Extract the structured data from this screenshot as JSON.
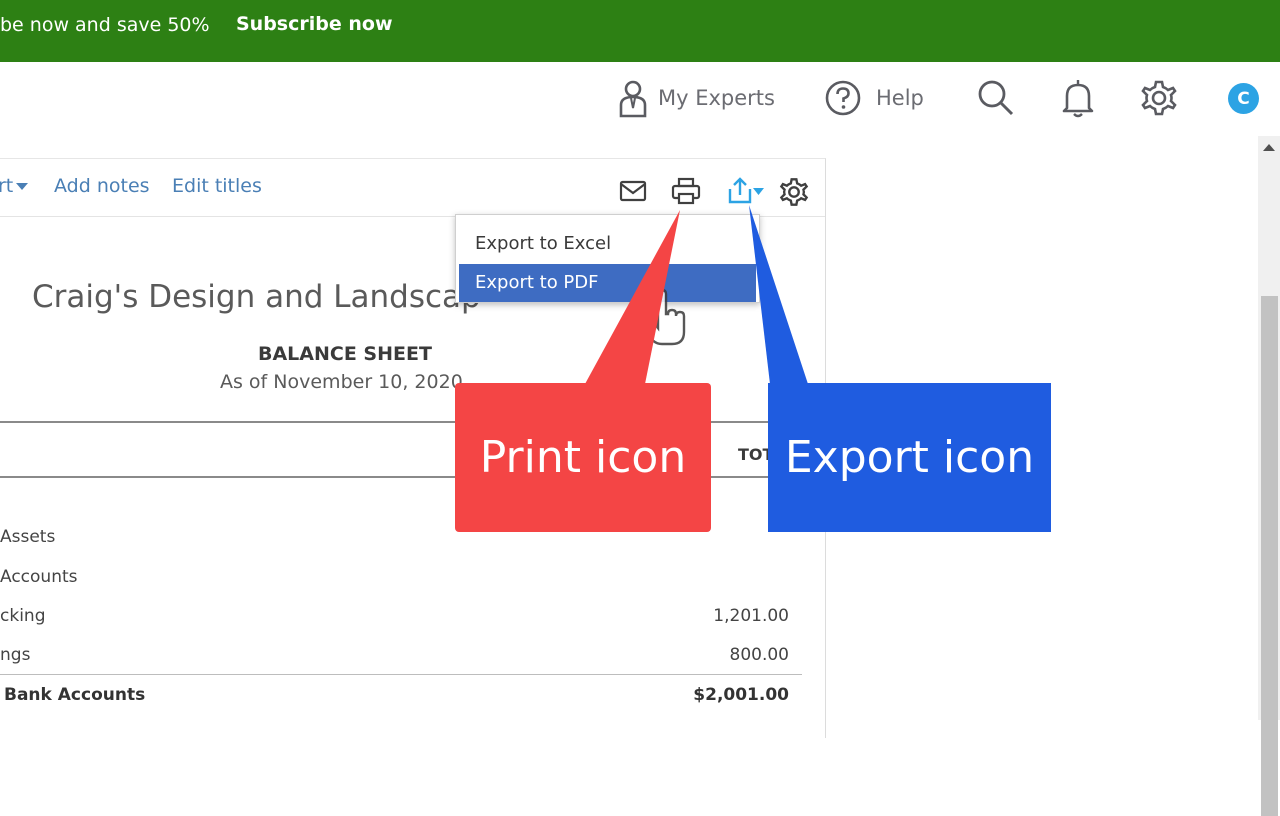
{
  "banner": {
    "text": "be now and save 50%",
    "cta": "Subscribe now"
  },
  "topbar": {
    "my_experts": "My Experts",
    "help": "Help",
    "search_icon": "search-icon",
    "bell_icon": "bell-icon",
    "gear_icon": "gear-icon",
    "avatar_initial": "C"
  },
  "toolbar": {
    "sort_label": "rt",
    "add_notes": "Add notes",
    "edit_titles": "Edit titles",
    "icons": [
      "email-icon",
      "print-icon",
      "export-icon",
      "settings-icon"
    ]
  },
  "report": {
    "company": "Craig's Design and Landscap",
    "title": "BALANCE SHEET",
    "date": "As of November 10, 2020",
    "column_header": "TOT",
    "rows": [
      {
        "label": "Assets",
        "value": ""
      },
      {
        "label": "Accounts",
        "value": ""
      },
      {
        "label": "cking",
        "value": "1,201.00"
      },
      {
        "label": "ngs",
        "value": "800.00"
      },
      {
        "label": "Bank Accounts",
        "value": "$2,001.00"
      }
    ]
  },
  "export_menu": {
    "items": [
      "Export to Excel",
      "Export to PDF"
    ],
    "selected": "Export to PDF"
  },
  "callouts": {
    "print": "Print icon",
    "export": "Export icon"
  },
  "colors": {
    "banner": "#2d8014",
    "link": "#4a7fb5",
    "print_callout": "#f44545",
    "export_callout": "#1f5ce0",
    "menu_selected": "#3e6cc2",
    "export_icon": "#2ca3e4"
  }
}
